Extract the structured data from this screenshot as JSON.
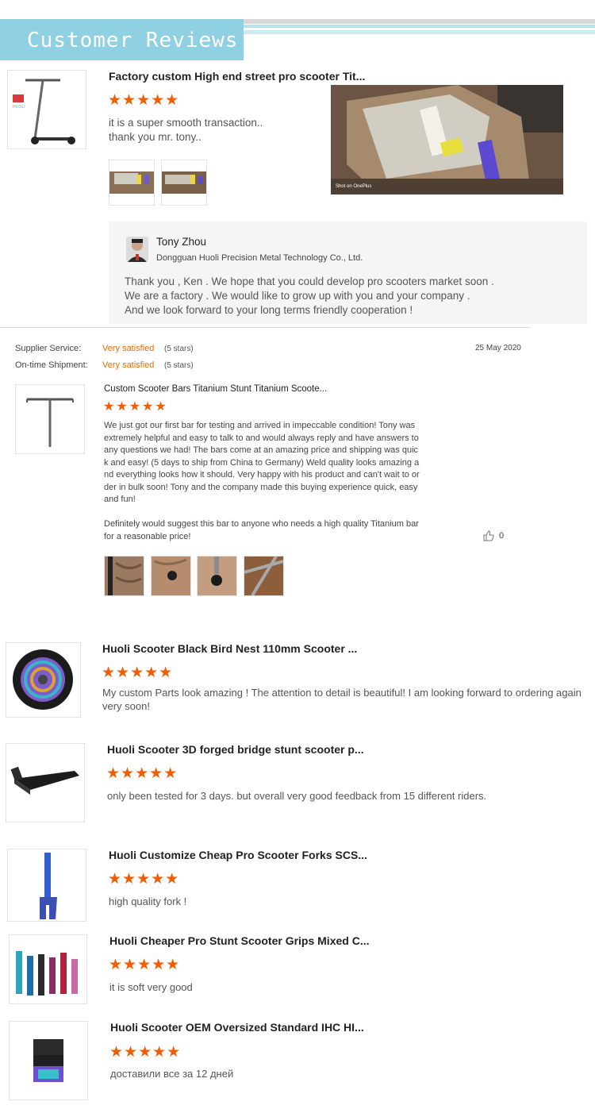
{
  "header": {
    "title": "Customer Reviews"
  },
  "review1": {
    "product": "Factory custom High end street pro scooter Tit...",
    "stars": "★★★★★",
    "text_line1": "it is a super smooth transaction..",
    "text_line2": "thank you mr. tony..",
    "photo_watermark": "Shot on OnePlus",
    "reply": {
      "name": "Tony Zhou",
      "company": "Dongguan Huoli Precision Metal Technology Co., Ltd.",
      "line1": "Thank you , Ken . We hope that you could develop pro scooters market soon .",
      "line2": "We are a factory . We would like to grow up with you and your company .",
      "line3": "And we look forward to your long terms friendly cooperation !"
    }
  },
  "review2": {
    "supplier_service_label": "Supplier Service:",
    "supplier_service_value": "Very satisfied",
    "supplier_service_stars": "(5 stars)",
    "shipment_label": "On-time Shipment:",
    "shipment_value": "Very satisfied",
    "shipment_stars": "(5 stars)",
    "date": "25 May 2020",
    "product": "Custom Scooter Bars Titanium Stunt Titanium Scoote...",
    "stars": "★★★★★",
    "body_lines": [
      "We just got our first bar for testing and arrived in impeccable condition! Tony was",
      "extremely helpful and easy to talk to and would always reply and have answers to",
      "any questions we had! The bars come at an amazing price and shipping was quic",
      "k and easy! (5 days to ship from China to Germany) Weld quality looks amazing a",
      "nd everything looks how it should. Very happy with his product and can't wait to or",
      "der in bulk soon! Tony and the company made this buying experience quick, easy",
      "and fun!"
    ],
    "body2_lines": [
      "Definitely would suggest this bar to anyone who needs a high quality Titanium bar",
      "for a reasonable price!"
    ],
    "likes": "0"
  },
  "review3": {
    "product": "Huoli Scooter Black Bird Nest 110mm Scooter ...",
    "stars": "★★★★★",
    "text_line1": "My custom Parts look amazing ! The attention to detail is beautiful! I am looking forward to ordering again",
    "text_line2": "very soon!"
  },
  "review4": {
    "product": "Huoli Scooter 3D forged bridge stunt scooter p...",
    "stars": "★★★★★",
    "text": "only been tested for 3 days. but overall very good feedback from 15 different riders."
  },
  "review5": {
    "product": "Huoli Customize Cheap Pro Scooter Forks SCS...",
    "stars": "★★★★★",
    "text": "high quality fork !"
  },
  "review6": {
    "product": "Huoli Cheaper Pro Stunt Scooter Grips Mixed C...",
    "stars": "★★★★★",
    "text": "it is soft very good"
  },
  "review7": {
    "product": "Huoli Scooter OEM Oversized Standard IHC HI...",
    "stars": "★★★★★",
    "text": "доставили все за 12 дней"
  },
  "colors": {
    "banner": "#8fd1e2",
    "star": "#f25c05",
    "satisfied": "#ef6c00",
    "reply_bg": "#f5f5f5"
  }
}
